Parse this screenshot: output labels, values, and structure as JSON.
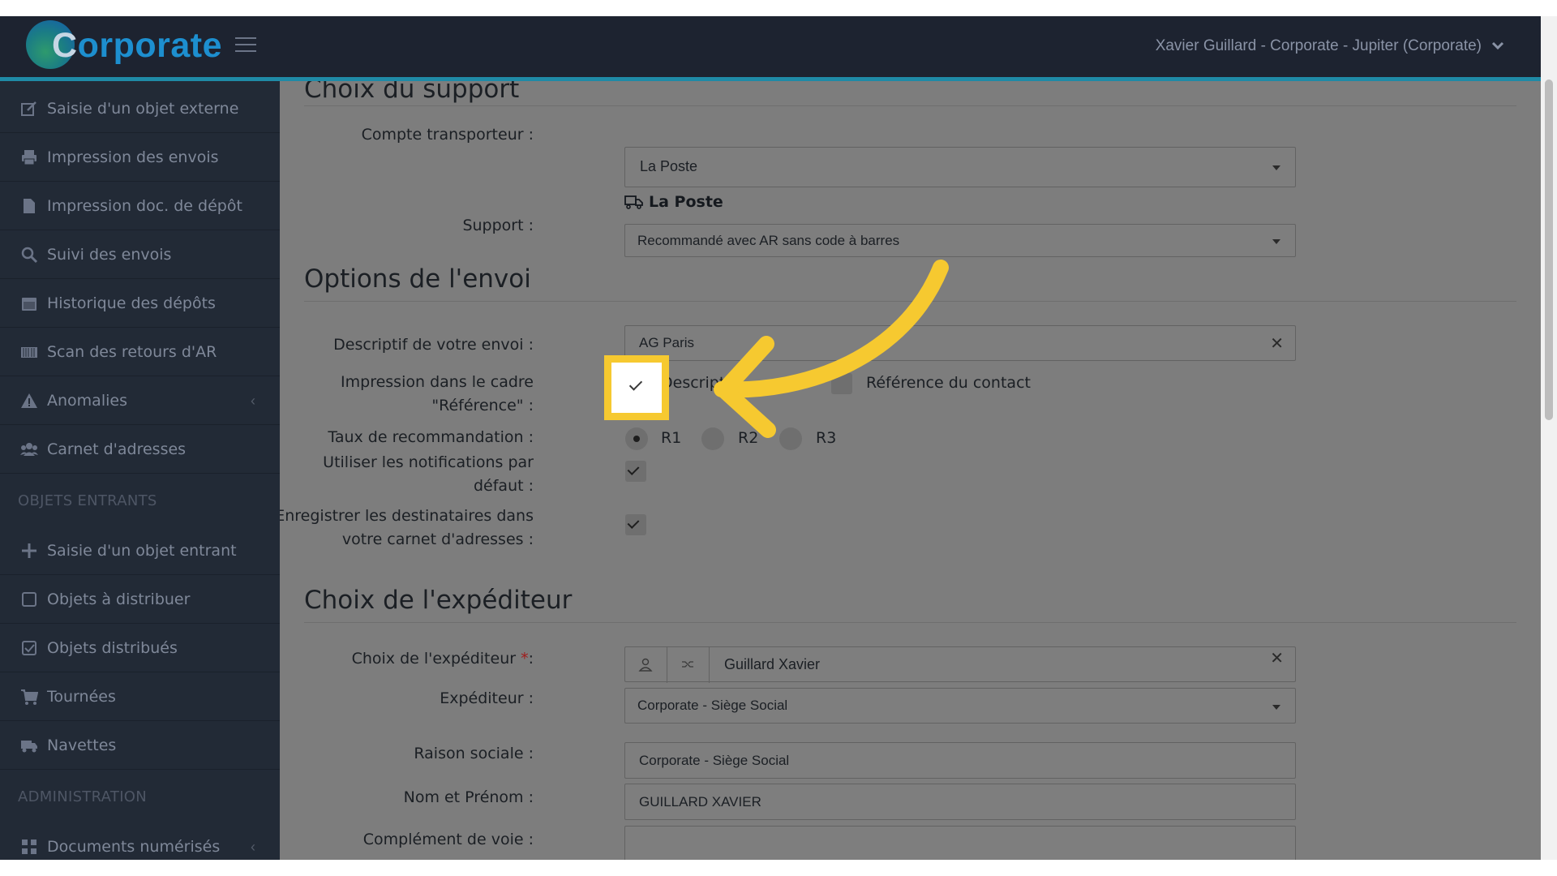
{
  "app": {
    "logo_text_first": "C",
    "logo_text_rest": "orporate",
    "user_menu": "Xavier Guillard - Corporate - Jupiter (Corporate)",
    "colors": {
      "topbar": "#1d2330",
      "accent_line": "#1f8aa6",
      "sidebar": "#222a36",
      "highlight": "#f6c930",
      "arrow": "#f6c930"
    }
  },
  "sidebar": {
    "items": [
      {
        "label": "Saisie d'un objet externe",
        "icon": "external-edit-icon"
      },
      {
        "label": "Impression des envois",
        "icon": "printer-icon"
      },
      {
        "label": "Impression doc. de dépôt",
        "icon": "document-icon"
      },
      {
        "label": "Suivi des envois",
        "icon": "search-icon"
      },
      {
        "label": "Historique des dépôts",
        "icon": "calendar-icon"
      },
      {
        "label": "Scan des retours d'AR",
        "icon": "barcode-icon"
      },
      {
        "label": "Anomalies",
        "icon": "warning-icon",
        "caret": "‹"
      },
      {
        "label": "Carnet d'adresses",
        "icon": "users-icon"
      }
    ],
    "section_incoming": "OBJETS ENTRANTS",
    "incoming_items": [
      {
        "label": "Saisie d'un objet entrant",
        "icon": "plus-icon"
      },
      {
        "label": "Objets à distribuer",
        "icon": "square-icon"
      },
      {
        "label": "Objets distribués",
        "icon": "checked-square-icon"
      },
      {
        "label": "Tournées",
        "icon": "cart-icon"
      },
      {
        "label": "Navettes",
        "icon": "truck-icon"
      }
    ],
    "section_admin": "ADMINISTRATION",
    "admin_items": [
      {
        "label": "Documents numérisés",
        "icon": "grid-icon",
        "caret": "‹"
      }
    ]
  },
  "support": {
    "title": "Choix du support",
    "carrier_label": "Compte transporteur :",
    "carrier_value": "La Poste",
    "carrier_name": "La Poste",
    "support_label": "Support :",
    "support_value": "Recommandé avec AR sans code à barres"
  },
  "options": {
    "title": "Options de l'envoi",
    "desc_label": "Descriptif de votre envoi :",
    "desc_value": "AG Paris",
    "print_label_1": "Impression dans le cadre",
    "print_label_2": "\"Référence\" :",
    "print_opt_desc": "Descripti",
    "print_opt_desc_checked": true,
    "print_opt_contact": "Référence du contact",
    "print_opt_contact_checked": false,
    "rate_label": "Taux de recommandation :",
    "rates": [
      "R1",
      "R2",
      "R3"
    ],
    "rate_selected": "R1",
    "notif_label_1": "Utiliser les notifications par",
    "notif_label_2": "défaut :",
    "notif_checked": true,
    "save_label_1": "Enregistrer les destinataires dans",
    "save_label_2": "votre carnet d'adresses :",
    "save_checked": true
  },
  "sender": {
    "title": "Choix de l'expéditeur",
    "choice_label": "Choix de l'expéditeur",
    "required_mark": "*",
    "choice_suffix": ":",
    "choice_value": "Guillard Xavier",
    "sender_label": "Expéditeur :",
    "sender_value": "Corporate - Siège Social",
    "company_label": "Raison sociale :",
    "company_value": "Corporate - Siège Social",
    "name_label": "Nom et Prénom :",
    "name_value": "GUILLARD XAVIER",
    "street_label": "Complément de voie :",
    "street_value": ""
  }
}
